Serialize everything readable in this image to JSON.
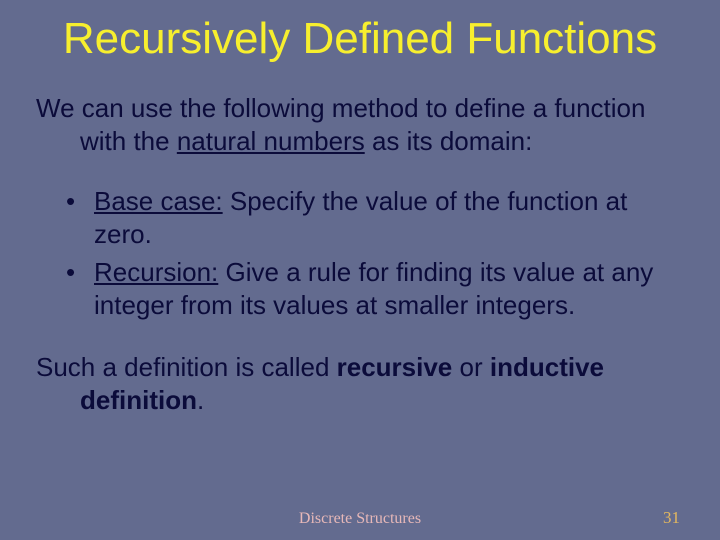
{
  "title": "Recursively Defined Functions",
  "intro_pre": "We can use the following method to define a function with the ",
  "intro_ul": "natural numbers",
  "intro_post": " as its domain:",
  "bullet1_label": "Base case:",
  "bullet1_text": " Specify the value of the function at zero.",
  "bullet2_label": "Recursion:",
  "bullet2_text": "  Give a rule for finding its value at any integer from its values at smaller integers.",
  "closing_pre": "Such a definition is called ",
  "closing_kw1": "recursive",
  "closing_mid": " or ",
  "closing_kw2": "inductive definition",
  "closing_post": ".",
  "footer_center": "Discrete Structures",
  "footer_right": "31"
}
